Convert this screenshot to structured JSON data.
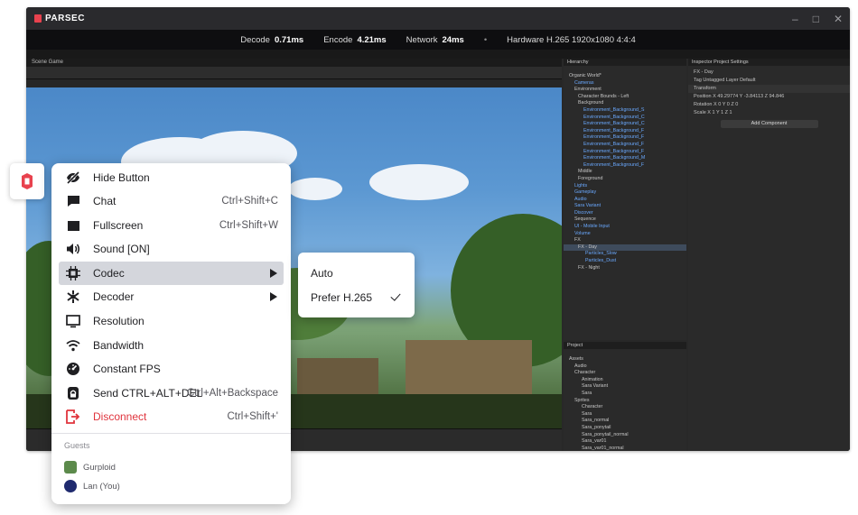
{
  "app": {
    "title": "PARSEC"
  },
  "stats": {
    "decode_label": "Decode",
    "decode_value": "0.71ms",
    "encode_label": "Encode",
    "encode_value": "4.21ms",
    "network_label": "Network",
    "network_value": "24ms",
    "separator": "•",
    "hardware": "Hardware H.265 1920x1080 4:4:4"
  },
  "menu": {
    "items": [
      {
        "label": "Hide Button",
        "shortcut": "",
        "icon": "eye-slash-icon"
      },
      {
        "label": "Chat",
        "shortcut": "Ctrl+Shift+C",
        "icon": "chat-bubble-icon"
      },
      {
        "label": "Fullscreen",
        "shortcut": "Ctrl+Shift+W",
        "icon": "fullscreen-icon"
      },
      {
        "label": "Sound [ON]",
        "shortcut": "",
        "icon": "speaker-icon"
      },
      {
        "label": "Codec",
        "shortcut": "",
        "icon": "chip-icon",
        "submenu": true,
        "active": true
      },
      {
        "label": "Decoder",
        "shortcut": "",
        "icon": "decoder-icon",
        "submenu": true
      },
      {
        "label": "Resolution",
        "shortcut": "",
        "icon": "monitor-icon"
      },
      {
        "label": "Bandwidth",
        "shortcut": "",
        "icon": "wifi-icon"
      },
      {
        "label": "Constant FPS",
        "shortcut": "",
        "icon": "gauge-icon"
      },
      {
        "label": "Send CTRL+ALT+DEL",
        "shortcut": "Ctrl+Alt+Backspace",
        "icon": "lock-icon"
      },
      {
        "label": "Disconnect",
        "shortcut": "Ctrl+Shift+'",
        "icon": "disconnect-icon",
        "danger": true
      }
    ],
    "guests_heading": "Guests",
    "guests": [
      {
        "name": "Gurploid"
      },
      {
        "name": "Lan (You)"
      }
    ]
  },
  "codec_submenu": {
    "options": [
      {
        "label": "Auto",
        "selected": false
      },
      {
        "label": "Prefer H.265",
        "selected": true
      }
    ]
  },
  "unity": {
    "game_tabs": "Scene   Game",
    "hierarchy_tab": "Hierarchy",
    "hierarchy": [
      "Organic World*",
      "Cameras",
      "Environment",
      "Character Bounds - Left",
      "Background",
      "Environment_Background_S",
      "Environment_Background_C",
      "Environment_Background_C",
      "Environment_Background_F",
      "Environment_Background_F",
      "Environment_Background_F",
      "Environment_Background_F",
      "Environment_Background_M",
      "Environment_Background_F",
      "Middle",
      "Foreground",
      "Lights",
      "Gameplay",
      "Audio",
      "Sara Variant",
      "Discover",
      "Sequence",
      "UI - Mobile Input",
      "Volume",
      "FX",
      "FX - Day",
      "Particles_Slow",
      "Particles_Dust",
      "FX - Night"
    ],
    "project_tab": "Project",
    "project": [
      "Assets",
      "Audio",
      "Character",
      "Animation",
      "Sara Variant",
      "Sara",
      "Sprites",
      "Character",
      "Sara",
      "Sara_normal",
      "Sara_ponytail",
      "Sara_ponytail_normal",
      "Sara_var01",
      "Sara_var01_normal"
    ],
    "inspector_tab": "Inspector   Project Settings",
    "inspector": {
      "object_name": "FX - Day",
      "tag_row": "Tag  Untagged        Layer  Default",
      "component": "Transform",
      "position": "Position     X 49.29774   Y -3.84113   Z 94.846",
      "rotation": "Rotation     X 0            Y 0            Z 0",
      "scale": "Scale         X 1            Y 1            Z 1",
      "add_component": "Add Component"
    }
  }
}
